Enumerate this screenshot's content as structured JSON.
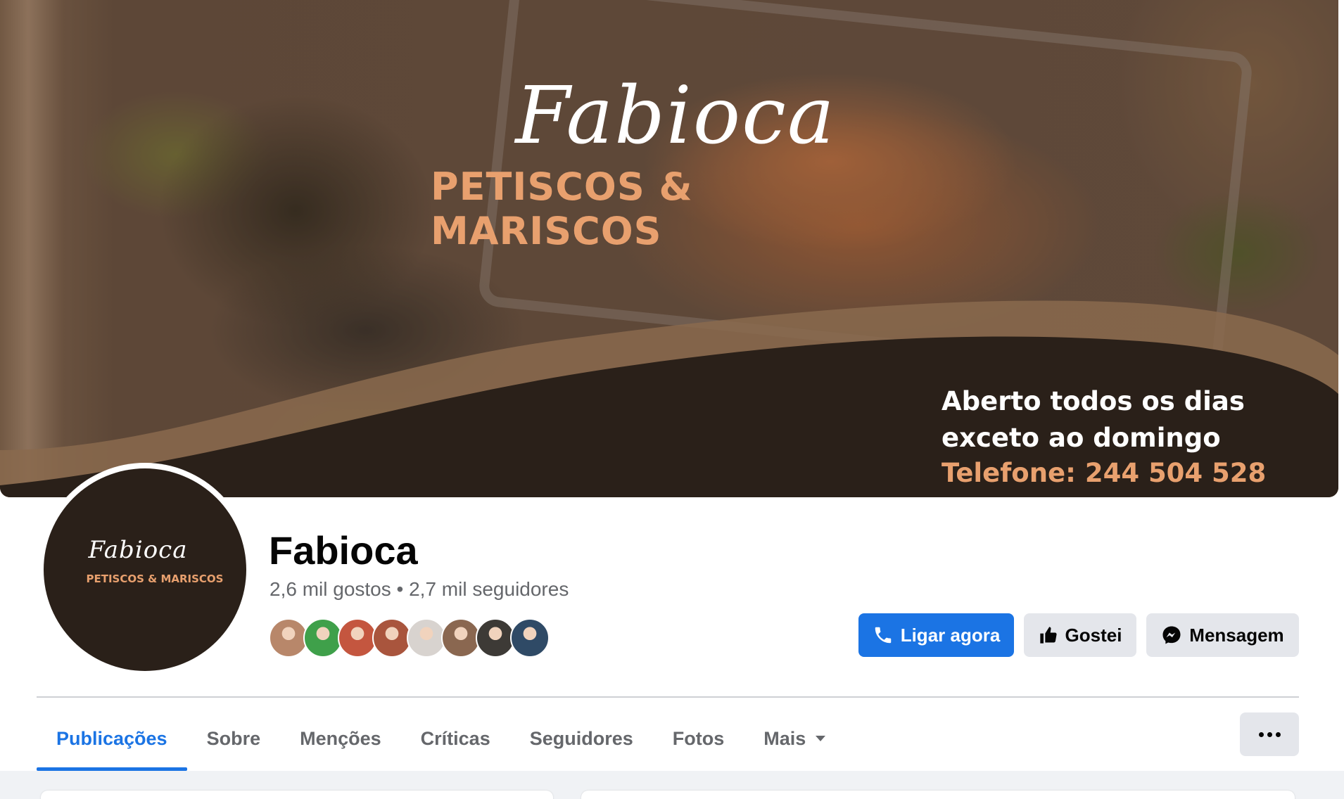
{
  "cover": {
    "brand_name": "Fabioca",
    "brand_subtitle": "PETISCOS & MARISCOS",
    "info_line_1": "Aberto todos os dias",
    "info_line_2": "exceto ao domingo",
    "phone_line": "Telefone: 244 504 528"
  },
  "profile": {
    "avatar_name": "Fabioca",
    "avatar_subtitle": "PETISCOS & MARISCOS",
    "page_name": "Fabioca",
    "stats": "2,6 mil gostos • 2,7 mil seguidores",
    "friend_avatar_colors": [
      "#b8876a",
      "#3fa04a",
      "#c4563f",
      "#a9553d",
      "#d8d3cf",
      "#8a6750",
      "#3d3a36",
      "#2f4a66"
    ]
  },
  "actions": {
    "call_label": "Ligar agora",
    "like_label": "Gostei",
    "message_label": "Mensagem",
    "call_icon": "phone-icon",
    "like_icon": "thumbs-up-icon",
    "message_icon": "messenger-icon"
  },
  "tabs": [
    {
      "label": "Publicações",
      "active": true
    },
    {
      "label": "Sobre"
    },
    {
      "label": "Menções"
    },
    {
      "label": "Críticas"
    },
    {
      "label": "Seguidores"
    },
    {
      "label": "Fotos"
    },
    {
      "label": "Mais"
    }
  ],
  "colors": {
    "accent": "#1b74e4",
    "brand_orange": "#e8a06e",
    "brand_dark": "#2a2019",
    "secondary_text": "#65676b",
    "button_gray": "#e4e6eb"
  }
}
